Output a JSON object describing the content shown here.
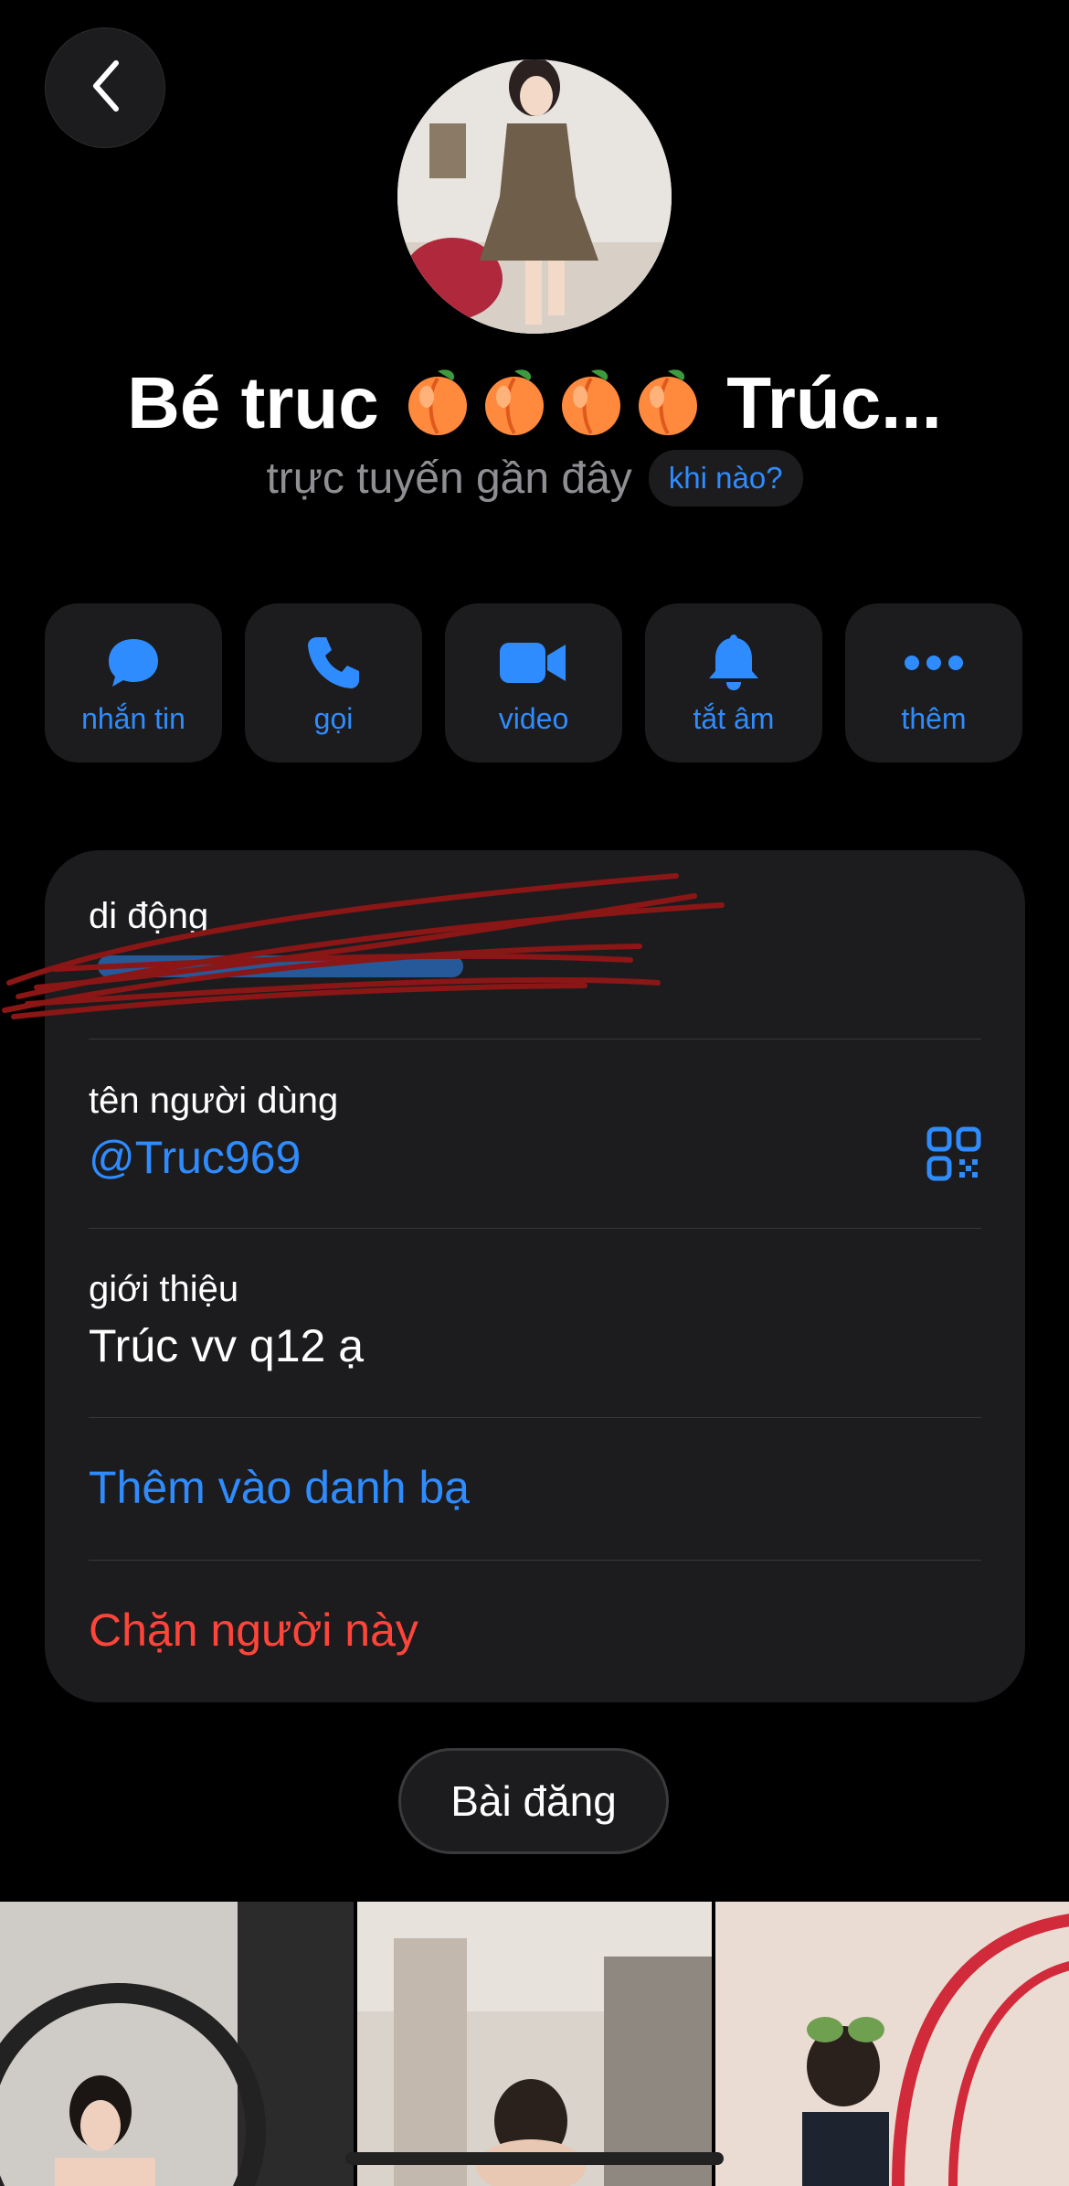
{
  "header": {
    "back_icon": "chevron-left-icon",
    "name": "Bé truc",
    "name_suffix": "Trúc...",
    "name_emoji": "🍑🍑🍑🍑",
    "status": "trực tuyến gần đây",
    "when_button": "khi nào?"
  },
  "actions": [
    {
      "label": "nhắn tin",
      "icon": "chat-bubble-icon"
    },
    {
      "label": "gọi",
      "icon": "phone-icon"
    },
    {
      "label": "video",
      "icon": "video-camera-icon"
    },
    {
      "label": "tắt âm",
      "icon": "bell-icon"
    },
    {
      "label": "thêm",
      "icon": "more-dots-icon"
    }
  ],
  "info": {
    "mobile_label": "di động",
    "username_label": "tên người dùng",
    "username": "@Truc969",
    "bio_label": "giới thiệu",
    "bio": "Trúc vv q12 ạ",
    "add_contact": "Thêm vào danh bạ",
    "block": "Chặn người này"
  },
  "posts_button": "Bài đăng",
  "colors": {
    "accent": "#2f8cff",
    "danger": "#ff453a",
    "card": "#1c1c1e",
    "background": "#000000"
  }
}
